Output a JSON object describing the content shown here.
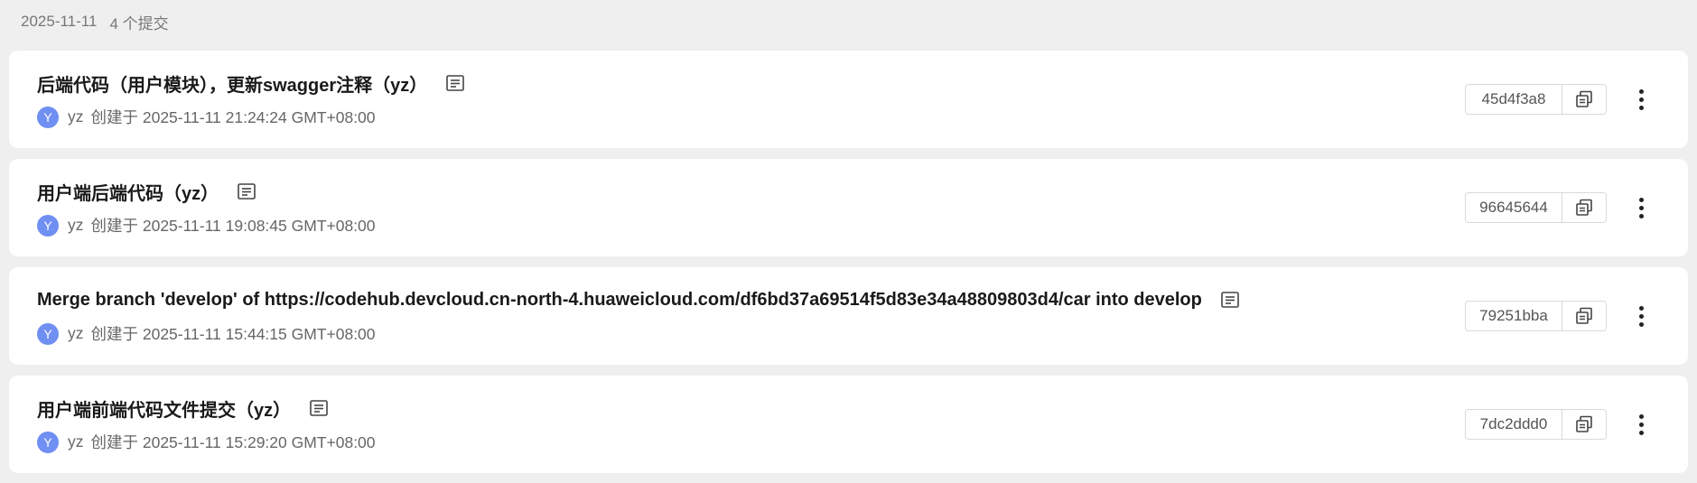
{
  "group": {
    "date": "2025-11-11",
    "count_label": "4 个提交"
  },
  "icons": {
    "message": "message-detail-icon",
    "copy": "copy-icon",
    "more": "more-vertical-icon"
  },
  "colors": {
    "avatar": "#6f8ff2",
    "background": "#efefef",
    "card": "#ffffff"
  },
  "commits": [
    {
      "title": "后端代码（用户模块），更新swagger注释（yz）",
      "avatar_letter": "Y",
      "author": "yz",
      "created": "创建于 2025-11-11 21:24:24 GMT+08:00",
      "hash": "45d4f3a8"
    },
    {
      "title": "用户端后端代码（yz）",
      "avatar_letter": "Y",
      "author": "yz",
      "created": "创建于 2025-11-11 19:08:45 GMT+08:00",
      "hash": "96645644"
    },
    {
      "title": "Merge branch 'develop' of https://codehub.devcloud.cn-north-4.huaweicloud.com/df6bd37a69514f5d83e34a48809803d4/car into develop",
      "avatar_letter": "Y",
      "author": "yz",
      "created": "创建于 2025-11-11 15:44:15 GMT+08:00",
      "hash": "79251bba"
    },
    {
      "title": "用户端前端代码文件提交（yz）",
      "avatar_letter": "Y",
      "author": "yz",
      "created": "创建于 2025-11-11 15:29:20 GMT+08:00",
      "hash": "7dc2ddd0"
    }
  ]
}
